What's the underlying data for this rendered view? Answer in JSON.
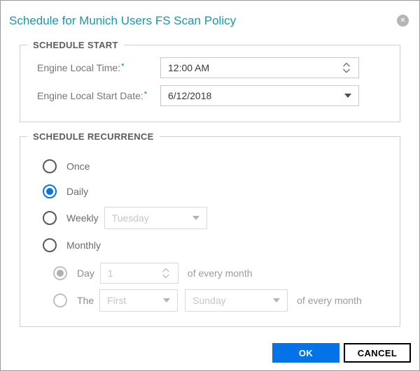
{
  "dialog": {
    "title": "Schedule for Munich Users FS Scan Policy",
    "selected_recurrence": "Daily"
  },
  "schedule_start": {
    "legend": "SCHEDULE START",
    "time_label": "Engine Local Time:",
    "time_required": "*",
    "time_value": "12:00 AM",
    "date_label": "Engine Local Start Date:",
    "date_required": "*",
    "date_value": "6/12/2018"
  },
  "schedule_recurrence": {
    "legend": "SCHEDULE RECURRENCE",
    "once_label": "Once",
    "daily_label": "Daily",
    "weekly_label": "Weekly",
    "weekly_day_value": "Tuesday",
    "monthly_label": "Monthly",
    "monthly_day_label": "Day",
    "monthly_day_value": "1",
    "monthly_day_suffix": "of every month",
    "monthly_the_label": "The",
    "monthly_ordinal_value": "First",
    "monthly_weekday_value": "Sunday",
    "monthly_the_suffix": "of every month"
  },
  "footer": {
    "ok_label": "OK",
    "cancel_label": "CANCEL"
  },
  "colors": {
    "title_teal": "#1f95a8",
    "accent_blue": "#0473e8",
    "selected_radio_blue": "#0b74e4",
    "legend_gray": "#5c5c5c",
    "label_gray": "#767676",
    "required_green": "#009900",
    "disabled_text_gray": "#c6c6c6",
    "fieldset_border_gray": "#cfcfcf"
  }
}
